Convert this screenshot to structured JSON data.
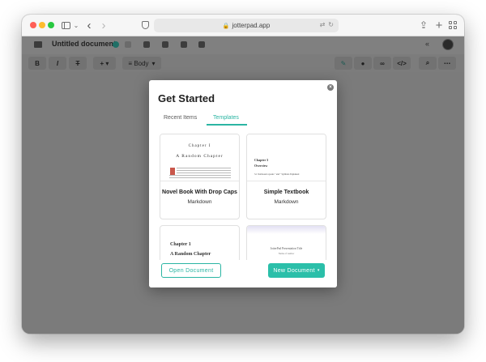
{
  "browser": {
    "url": "jotterpad.app",
    "back_icon": "chevron-left-icon",
    "forward_icon": "chevron-right-icon"
  },
  "app": {
    "document_title": "Untitled document",
    "format": {
      "bold": "B",
      "italic": "I",
      "strike": "T",
      "insert": "+ ▾",
      "style": "Body",
      "style_caret": "▾",
      "code": "</>",
      "search": "⌕",
      "more": "⋯"
    },
    "collapse": "«"
  },
  "modal": {
    "title": "Get Started",
    "tabs": [
      "Recent Items",
      "Templates"
    ],
    "active_tab": "Templates",
    "close_icon": "close-icon",
    "templates": [
      {
        "name": "Novel Book With Drop Caps",
        "type": "Markdown",
        "preview_heading": "Chapter I",
        "preview_title": "A Random Chapter"
      },
      {
        "name": "Simple Textbook",
        "type": "Markdown",
        "preview_heading": "Chapter 3",
        "preview_title": "Overview",
        "preview_line": "3.1   Textbook Layouts  \" and \"  Symbols Explained"
      },
      {
        "name": "",
        "type": "",
        "preview_heading": "Chapter 1",
        "preview_title": "A Random Chapter"
      },
      {
        "name": "",
        "type": "",
        "preview_heading": "JotterPad Presentation Title",
        "preview_title": "Name of Author"
      }
    ],
    "open_button": "Open Document",
    "new_button": "New Document",
    "new_caret": "▾"
  },
  "colors": {
    "accent": "#2bb5a3",
    "overlay": "#7b7b7b"
  }
}
